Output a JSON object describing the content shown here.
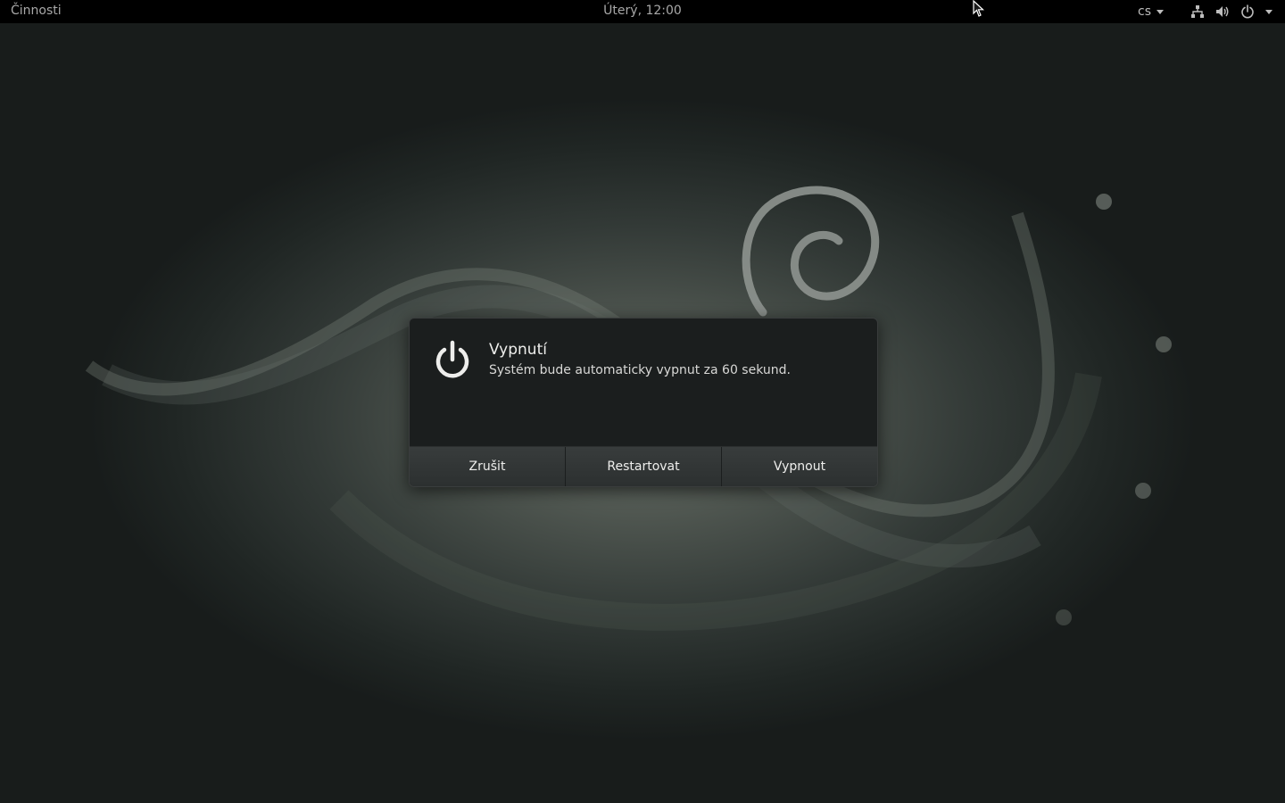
{
  "top_bar": {
    "activities_label": "Činnosti",
    "clock": "Úterý, 12:00",
    "language": "cs",
    "icons": [
      "network-icon",
      "volume-icon",
      "power-icon"
    ]
  },
  "dialog": {
    "icon": "power-icon",
    "title": "Vypnutí",
    "message": "Systém bude automaticky vypnut za 60 sekund.",
    "buttons": {
      "cancel": "Zrušit",
      "restart": "Restartovat",
      "shutdown": "Vypnout"
    }
  },
  "colors": {
    "top_bar_bg": "#000000",
    "dialog_bg": "#1b1e1e",
    "button_bg": "#353939",
    "wallpaper_accent": "#8a918a"
  }
}
